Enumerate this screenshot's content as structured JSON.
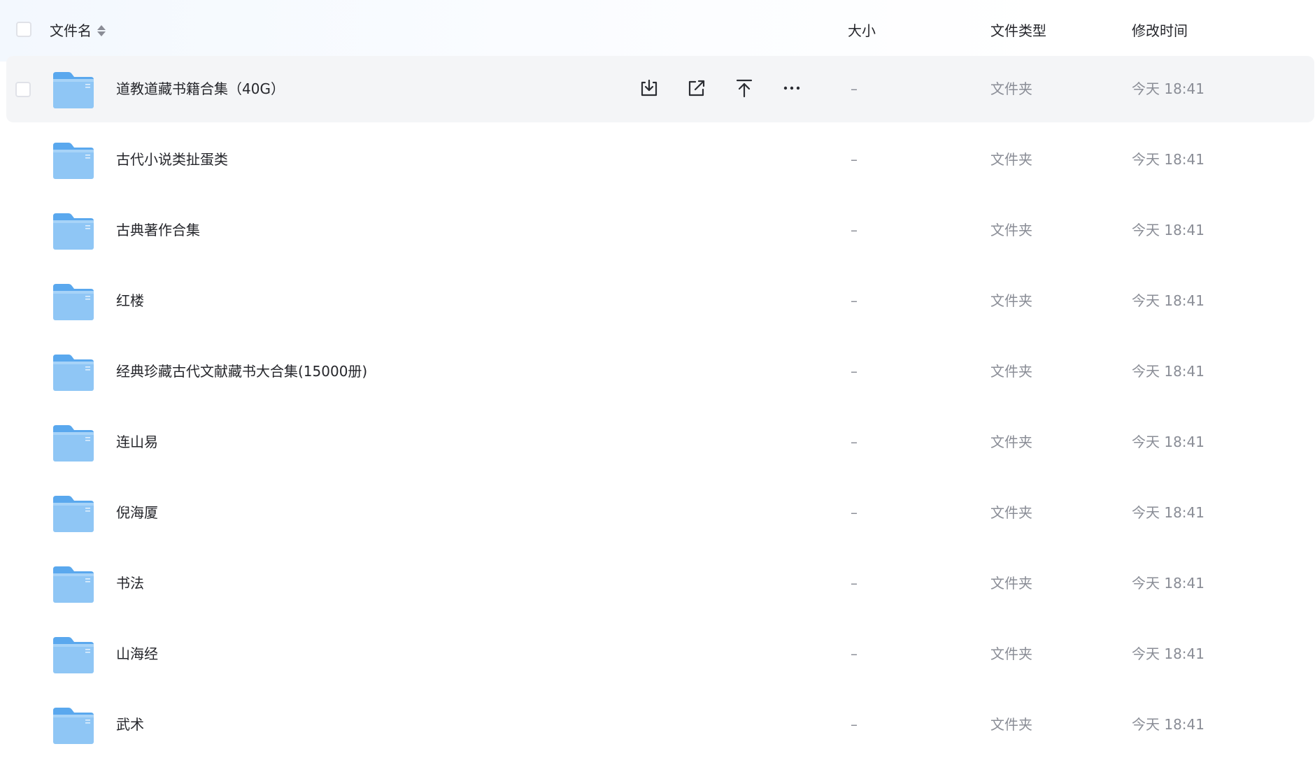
{
  "header": {
    "name": "文件名",
    "size": "大小",
    "type": "文件类型",
    "time": "修改时间"
  },
  "files": [
    {
      "name": "道教道藏书籍合集（40G）",
      "size": "–",
      "type": "文件夹",
      "time": "今天 18:41"
    },
    {
      "name": "古代小说类扯蛋类",
      "size": "–",
      "type": "文件夹",
      "time": "今天 18:41"
    },
    {
      "name": "古典著作合集",
      "size": "–",
      "type": "文件夹",
      "time": "今天 18:41"
    },
    {
      "name": "红楼",
      "size": "–",
      "type": "文件夹",
      "time": "今天 18:41"
    },
    {
      "name": "经典珍藏古代文献藏书大合集(15000册)",
      "size": "–",
      "type": "文件夹",
      "time": "今天 18:41"
    },
    {
      "name": "连山易",
      "size": "–",
      "type": "文件夹",
      "time": "今天 18:41"
    },
    {
      "name": " 倪海厦",
      "size": "–",
      "type": "文件夹",
      "time": "今天 18:41"
    },
    {
      "name": "书法",
      "size": "–",
      "type": "文件夹",
      "time": "今天 18:41"
    },
    {
      "name": "山海经",
      "size": "–",
      "type": "文件夹",
      "time": "今天 18:41"
    },
    {
      "name": "武术",
      "size": "–",
      "type": "文件夹",
      "time": "今天 18:41"
    }
  ],
  "icons": {
    "folder": "folder-icon",
    "download": "download-icon",
    "share": "share-icon",
    "move": "move-to-top-icon",
    "more": "more-icon"
  },
  "colors": {
    "folder_light": "#8fc6f5",
    "folder_dark": "#5aa8ee",
    "hover_row": "#f4f5f7"
  }
}
